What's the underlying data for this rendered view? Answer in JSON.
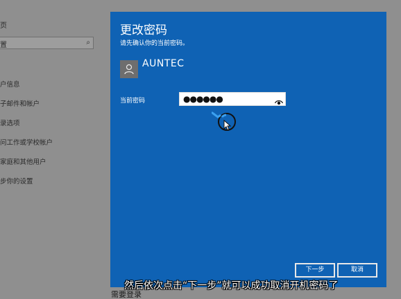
{
  "background": {
    "nav_home": "页",
    "search_placeholder": "置",
    "search_icon": "search-icon",
    "nav_items": [
      "户信息",
      "子邮件和帐户",
      "录选项",
      "问工作或学校帐户",
      "家庭和其他用户",
      "步你的设置"
    ],
    "bottom_text": "需要登录"
  },
  "dialog": {
    "title": "更改密码",
    "subtitle": "请先确认你的当前密码。",
    "user_name": "AUNTEC",
    "field_label": "当前密码",
    "password_value": "●●●●●●",
    "next_button": "下一步",
    "cancel_button": "取消",
    "accent_color": "#0f62b4"
  },
  "caption": {
    "text": "然后依次点击“下一步”就可以成功取消开机密码了"
  }
}
